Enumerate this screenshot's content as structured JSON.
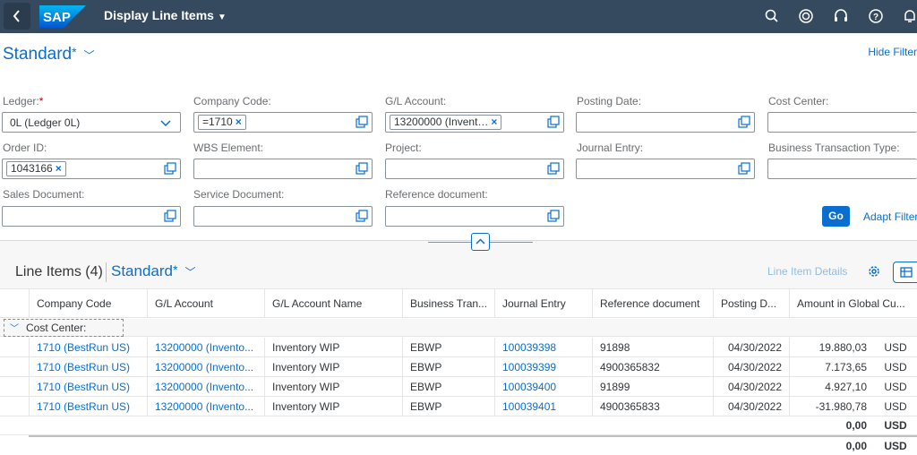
{
  "shell": {
    "title": "Display Line Items",
    "logo_text": "SAP",
    "icons": [
      "search-icon",
      "copilot-icon",
      "headset-icon",
      "help-icon",
      "bell-icon"
    ],
    "bar_color": "#354a5f"
  },
  "filterbar": {
    "variant_name": "Standard",
    "variant_modified": "*",
    "hide_filter": "Hide Filter",
    "go": "Go",
    "adapt": "Adapt Filter",
    "fields": {
      "ledger": {
        "label": "Ledger:",
        "required": "*",
        "value": "0L (Ledger 0L)"
      },
      "company_code": {
        "label": "Company Code:",
        "token": "=1710"
      },
      "gl_account": {
        "label": "G/L Account:",
        "token": "13200000 (Invent…"
      },
      "posting_date": {
        "label": "Posting Date:"
      },
      "cost_center": {
        "label": "Cost Center:"
      },
      "order_id": {
        "label": "Order ID:",
        "token": "1043166"
      },
      "wbs_element": {
        "label": "WBS Element:"
      },
      "project": {
        "label": "Project:"
      },
      "journal_entry": {
        "label": "Journal Entry:"
      },
      "business_transaction_type": {
        "label": "Business Transaction Type:"
      },
      "sales_document": {
        "label": "Sales Document:"
      },
      "service_document": {
        "label": "Service Document:"
      },
      "reference_document": {
        "label": "Reference document:"
      }
    }
  },
  "table": {
    "title": "Line Items (4)",
    "variant_name": "Standard",
    "variant_modified": "*",
    "line_item_details": "Line Item Details",
    "columns": [
      "Company Code",
      "G/L Account",
      "G/L Account Name",
      "Business Tran...",
      "Journal Entry",
      "Reference document",
      "Posting D...",
      "Amount in Global Cu..."
    ],
    "group_label": "Cost Center:",
    "rows": [
      {
        "company_code": "1710 (BestRun US)",
        "gl_account": "13200000 (Invento...",
        "gl_name": "Inventory WIP",
        "btt": "EBWP",
        "journal_entry": "100039398",
        "ref_doc": "91898",
        "posting_date": "04/30/2022",
        "amount": "19.880,03",
        "currency": "USD"
      },
      {
        "company_code": "1710 (BestRun US)",
        "gl_account": "13200000 (Invento...",
        "gl_name": "Inventory WIP",
        "btt": "EBWP",
        "journal_entry": "100039399",
        "ref_doc": "4900365832",
        "posting_date": "04/30/2022",
        "amount": "7.173,65",
        "currency": "USD"
      },
      {
        "company_code": "1710 (BestRun US)",
        "gl_account": "13200000 (Invento...",
        "gl_name": "Inventory WIP",
        "btt": "EBWP",
        "journal_entry": "100039400",
        "ref_doc": "91899",
        "posting_date": "04/30/2022",
        "amount": "4.927,10",
        "currency": "USD"
      },
      {
        "company_code": "1710 (BestRun US)",
        "gl_account": "13200000 (Invento...",
        "gl_name": "Inventory WIP",
        "btt": "EBWP",
        "journal_entry": "100039401",
        "ref_doc": "4900365833",
        "posting_date": "04/30/2022",
        "amount": "-31.980,78",
        "currency": "USD"
      }
    ],
    "subtotal": {
      "amount": "0,00",
      "currency": "USD"
    },
    "grand_total": {
      "amount": "0,00",
      "currency": "USD"
    }
  },
  "colors": {
    "accent": "#0a6ed1",
    "required": "#bb0000"
  }
}
